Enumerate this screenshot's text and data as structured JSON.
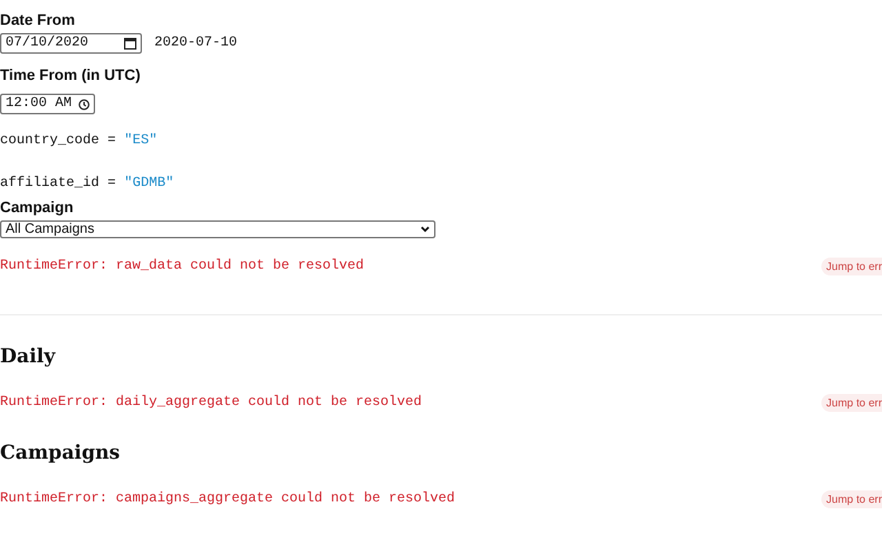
{
  "cells": [
    {
      "kind": "date",
      "label": "Date From",
      "value": "07/10/2020",
      "output": "2020-07-10"
    },
    {
      "kind": "time",
      "label": "Time From (in UTC)",
      "value": "12:00 AM"
    },
    {
      "kind": "assign",
      "name": "country_code",
      "operator": "=",
      "value": "\"ES\""
    },
    {
      "kind": "assign",
      "name": "affiliate_id",
      "operator": "=",
      "value": "\"GDMB\""
    },
    {
      "kind": "select",
      "label": "Campaign",
      "value": "All Campaigns"
    },
    {
      "kind": "error",
      "message": "RuntimeError: raw_data could not be resolved",
      "action": "Jump to err"
    },
    {
      "kind": "divider"
    },
    {
      "kind": "heading",
      "text": "Daily"
    },
    {
      "kind": "error",
      "message": "RuntimeError: daily_aggregate could not be resolved",
      "action": "Jump to err"
    },
    {
      "kind": "heading",
      "text": "Campaigns"
    },
    {
      "kind": "error",
      "message": "RuntimeError: campaigns_aggregate could not be resolved",
      "action": "Jump to err"
    }
  ]
}
